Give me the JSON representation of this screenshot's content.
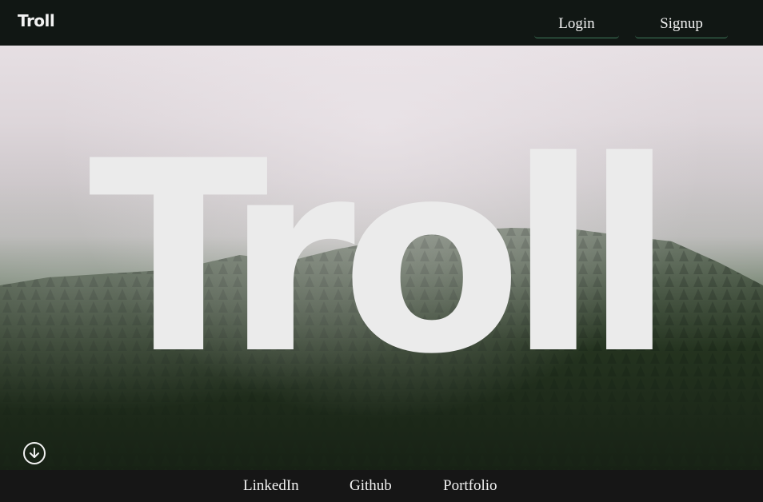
{
  "header": {
    "brand": "Troll",
    "login_label": "Login",
    "signup_label": "Signup"
  },
  "hero": {
    "title": "Troll",
    "scroll_icon": "arrow-down-circle-icon"
  },
  "footer": {
    "links": [
      {
        "label": "LinkedIn"
      },
      {
        "label": "Github"
      },
      {
        "label": "Portfolio"
      }
    ]
  },
  "colors": {
    "topbar": "#111714",
    "footer": "#161616",
    "accent_underline": "#3f7a5a",
    "title_fill": "#ebebeb"
  }
}
